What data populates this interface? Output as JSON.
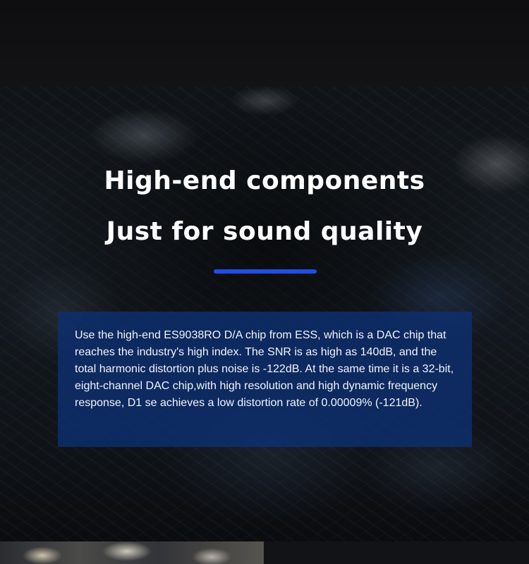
{
  "hero": {
    "heading_line1": "High-end components",
    "heading_line2": "Just for sound quality",
    "accent_color": "#1f4fe8"
  },
  "description": {
    "text": "Use the high-end ES9038RO D/A chip from ESS, which is a DAC chip that reaches the industry's high index. The SNR is as high as 140dB, and the total harmonic distortion plus noise is -122dB. At the same time it is a 32-bit, eight-channel DAC chip,with high resolution and high dynamic frequency response, D1 se achieves a low distortion rate of 0.00009% (-121dB).",
    "box_color": "#0e3070"
  }
}
